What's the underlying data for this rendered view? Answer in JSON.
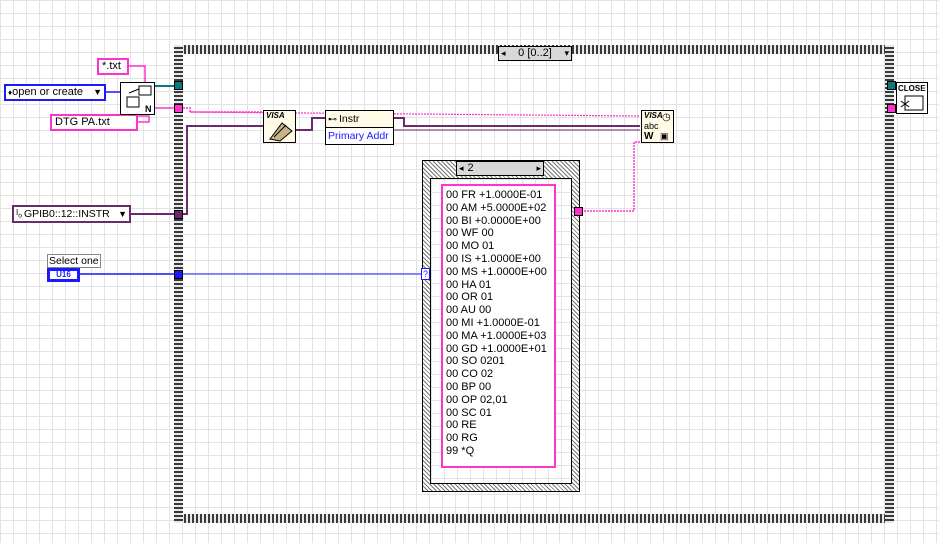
{
  "outer_structure": {
    "frame_selector": "0 [0..2]",
    "left_arrow": "◂",
    "right_arrow": "▾"
  },
  "inner_case": {
    "selector_value": "2",
    "left_arrow": "◂",
    "right_arrow": "▸",
    "commands": [
      "00 FR +1.0000E-01",
      "00 AM +5.0000E+02",
      "00 BI +0.0000E+00",
      "00 WF 00",
      "00 MO 01",
      "00 IS +1.0000E+00",
      "00 MS +1.0000E+00",
      "00 HA 01",
      "00 OR 01",
      "00 AU 00",
      "00 MI +1.0000E-01",
      "00 MA +1.0000E+03",
      "00 GD +1.0000E+01",
      "00 SO 0201",
      "00 CO 02",
      "00 BP 00",
      "00 OP 02,01",
      "00 SC 01",
      "00 RE",
      "00 RG",
      "99 *Q"
    ]
  },
  "constants": {
    "pattern": "*.txt",
    "file_name": "DTG PA.txt",
    "open_mode": "open or create",
    "visa_resource": "GPIB0::12::INSTR",
    "select_label": "Select one",
    "select_type": "U16"
  },
  "nodes": {
    "property_instr": "Instr",
    "property_primary": "Primary Addr",
    "visa_open_label": "VISA",
    "visa_write_label": "VISA",
    "visa_write_sub": "abc",
    "visa_write_w": "W",
    "close_label": "CLOSE"
  },
  "colors": {
    "string_wire": "#ff33cc",
    "refnum_wire": "#6b2b6b",
    "integer_wire": "#1a1aff",
    "file_wire": "#0b7a7a"
  }
}
